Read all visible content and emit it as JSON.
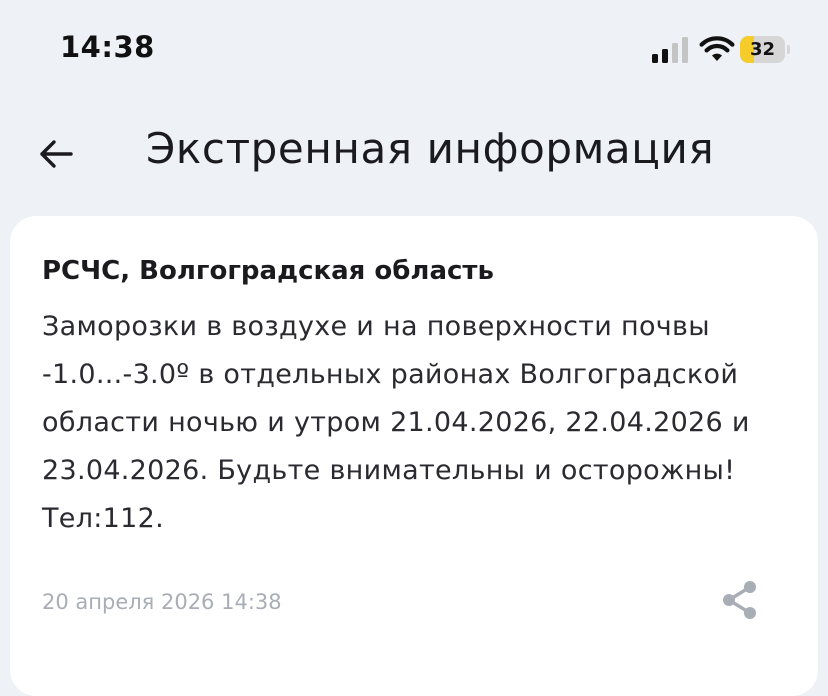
{
  "status_bar": {
    "time": "14:38",
    "battery_level": "32",
    "battery_fraction": 0.32,
    "battery_color": "#f5cc2a",
    "signal_icon": "cellular-signal-icon",
    "wifi_icon": "wifi-icon"
  },
  "header": {
    "back_icon": "arrow-left-icon",
    "title": "Экстренная информация"
  },
  "alert": {
    "source": "РСЧС, Волгоградская область",
    "message": "Заморозки в воздухе и на поверхности почвы -1.0...-3.0º в отдельных районах Волгоградской области ночью и утром 21.04.2026, 22.04.2026 и 23.04.2026. Будьте внимательны и осторожны! Тел:112.",
    "date": "20 апреля 2026 14:38",
    "share_icon": "share-icon"
  }
}
